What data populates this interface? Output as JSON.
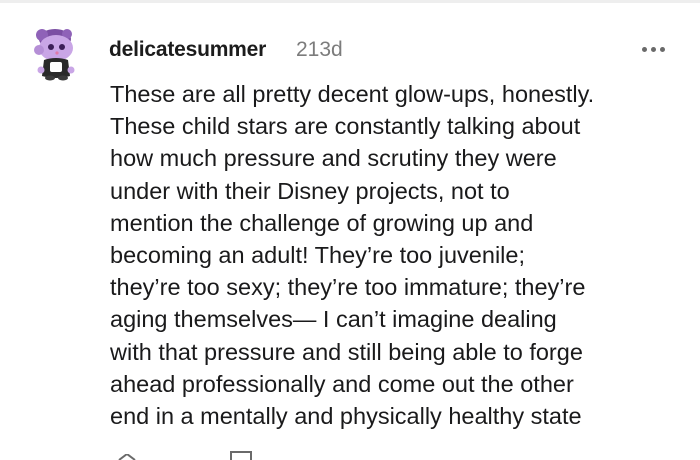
{
  "comment": {
    "username": "delicatesummer",
    "timestamp": "213d",
    "body": "These are all pretty decent glow-ups, honestly.\nThese child stars are constantly talking about\nhow much pressure and scrutiny they were\nunder with their Disney projects, not to\nmention the challenge of growing up and\nbecoming an adult! They’re too juvenile;\nthey’re too sexy; they’re too immature; they’re\naging themselves— I can’t imagine dealing\nwith that pressure and still being able to forge\nahead professionally and come out the other\nend in a mentally and physically healthy state"
  },
  "icons": {
    "avatar": "snoo-avatar-icon",
    "more": "more-options-icon",
    "upvote": "upvote-icon",
    "reply": "reply-icon"
  },
  "colors": {
    "username": "#1c1c1c",
    "timestamp": "#7c7c7c",
    "avatar_purple": "#b58fd6",
    "avatar_dark": "#2a2a2a"
  }
}
